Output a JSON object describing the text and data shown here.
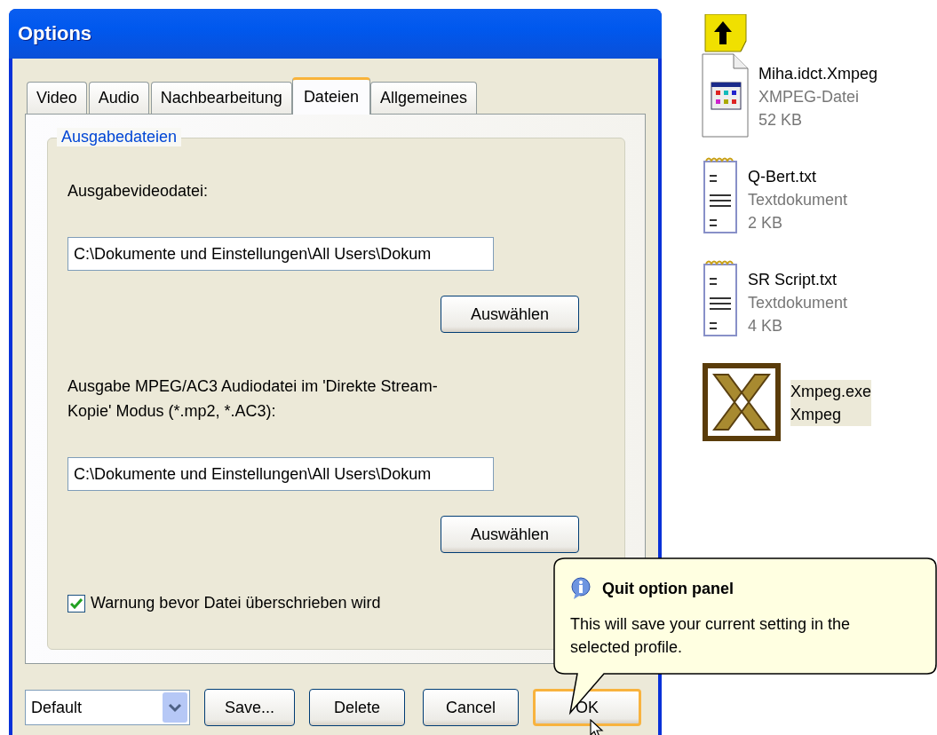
{
  "window": {
    "title": "Options"
  },
  "tabs": [
    {
      "label": "Video",
      "selected": false
    },
    {
      "label": "Audio",
      "selected": false
    },
    {
      "label": "Nachbearbeitung",
      "selected": false
    },
    {
      "label": "Dateien",
      "selected": true
    },
    {
      "label": "Allgemeines",
      "selected": false
    }
  ],
  "group": {
    "legend": "Ausgabedateien",
    "fields": [
      {
        "label": "Ausgabevideodatei:",
        "value": "C:\\Dokumente und Einstellungen\\All Users\\Dokum",
        "button": "Auswählen"
      },
      {
        "label": "Ausgabe MPEG/AC3 Audiodatei im 'Direkte Stream-Kopie' Modus (*.mp2, *.AC3):",
        "value": "C:\\Dokumente und Einstellungen\\All Users\\Dokum",
        "button": "Auswählen"
      }
    ],
    "checkbox": {
      "label": "Warnung bevor Datei überschrieben wird",
      "checked": true
    }
  },
  "profile": {
    "value": "Default"
  },
  "buttons": [
    {
      "label": "Save...",
      "default": false
    },
    {
      "label": "Delete",
      "default": false
    },
    {
      "label": "Cancel",
      "default": false
    },
    {
      "label": "OK",
      "default": true
    }
  ],
  "tooltip": {
    "title": "Quit option panel",
    "text": "This will save your current setting in the selected profile."
  },
  "files": [
    {
      "kind": "upfolder",
      "selected": false
    },
    {
      "kind": "xmpeg",
      "name": "Miha.idct.Xmpeg",
      "type": "XMPEG-Datei",
      "size": "52 KB",
      "selected": false
    },
    {
      "kind": "text",
      "name": "Q-Bert.txt",
      "type": "Textdokument",
      "size": "2 KB",
      "selected": false
    },
    {
      "kind": "text",
      "name": "SR Script.txt",
      "type": "Textdokument",
      "size": "4 KB",
      "selected": false
    },
    {
      "kind": "exe",
      "name": "Xmpeg.exe",
      "type": "Xmpeg",
      "selected": true
    }
  ]
}
